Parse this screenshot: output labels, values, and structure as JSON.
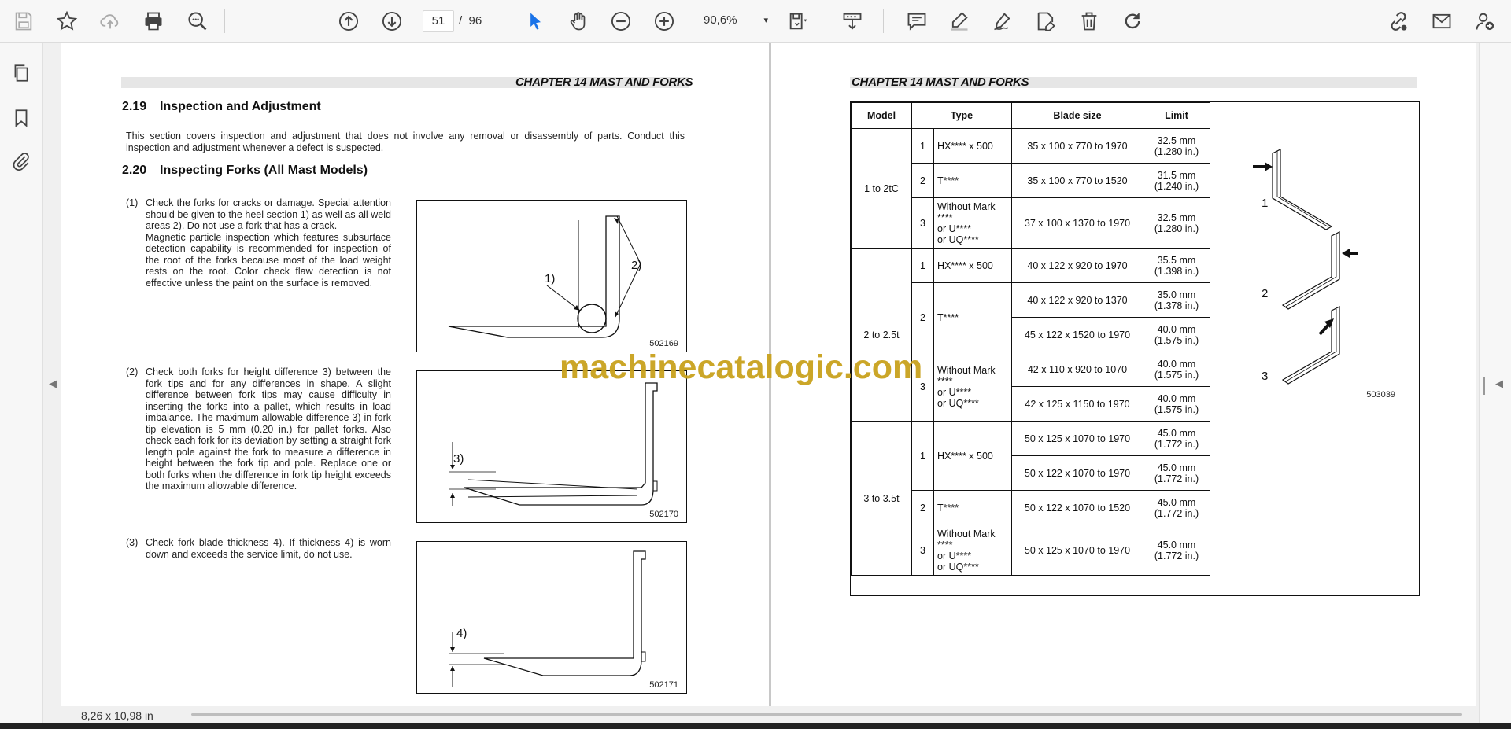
{
  "toolbar": {
    "page_current": "51",
    "page_separator": "/",
    "page_total": "96",
    "zoom": "90,6%",
    "zoom_caret": "▾"
  },
  "left_page": {
    "chapter": "CHAPTER 14 MAST AND FORKS",
    "section1": {
      "num": "2.19",
      "title": "Inspection and Adjustment"
    },
    "section1_text": "This section covers inspection and adjustment that does not involve any removal or disassembly of parts. Conduct this inspection and adjustment whenever a defect is suspected.",
    "section2": {
      "num": "2.20",
      "title": "Inspecting Forks (All Mast Models)"
    },
    "items": [
      {
        "num": "(1)",
        "text": "Check the forks for cracks or damage. Special attention should be given to the heel section 1) as well as all weld areas 2). Do not use a fork that has a crack.\nMagnetic particle inspection which features subsurface detection capability is recommended for inspection of the root of the forks because most of the load weight rests on the root. Color check flaw detection is not effective unless the paint on the surface is removed."
      },
      {
        "num": "(2)",
        "text": "Check both forks for height difference 3) between the fork tips and for any differences in shape. A slight difference between fork tips may cause difficulty in inserting the forks into a pallet, which results in load imbalance. The maximum allowable difference 3) in fork tip elevation is 5 mm (0.20 in.) for pallet forks. Also check each fork for its deviation by setting a straight fork length pole against the fork to measure a difference in height between the fork tip and pole. Replace one or both forks when the difference in fork tip height exceeds the maximum allowable difference."
      },
      {
        "num": "(3)",
        "text": "Check fork blade thickness 4). If thickness 4) is worn down and exceeds the service limit, do not use."
      }
    ],
    "figures": [
      {
        "code": "502169",
        "label_a": "1)",
        "label_b": "2)"
      },
      {
        "code": "502170",
        "label_a": "3)"
      },
      {
        "code": "502171",
        "label_a": "4)"
      }
    ]
  },
  "right_page": {
    "chapter": "CHAPTER 14 MAST AND FORKS",
    "table_headers": [
      "Model",
      "Type",
      "Blade size",
      "Limit"
    ],
    "groups": [
      {
        "model": "1 to 2tC",
        "rows": [
          {
            "n": "1",
            "type": [
              "HX**** x 500"
            ],
            "blades": [
              {
                "size": "35 x 100 x 770 to 1970",
                "limit": "32.5 mm",
                "limit_in": "(1.280 in.)"
              }
            ]
          },
          {
            "n": "2",
            "type": [
              "T****"
            ],
            "blades": [
              {
                "size": "35 x 100 x 770 to 1520",
                "limit": "31.5 mm",
                "limit_in": "(1.240 in.)"
              }
            ]
          },
          {
            "n": "3",
            "type": [
              "Without Mark",
              "****",
              "or U****",
              "or UQ****"
            ],
            "blades": [
              {
                "size": "37 x 100 x 1370 to 1970",
                "limit": "32.5 mm",
                "limit_in": "(1.280 in.)"
              }
            ]
          }
        ]
      },
      {
        "model": "2 to 2.5t",
        "rows": [
          {
            "n": "1",
            "type": [
              "HX**** x 500"
            ],
            "blades": [
              {
                "size": "40 x 122 x 920 to 1970",
                "limit": "35.5 mm",
                "limit_in": "(1.398 in.)"
              }
            ]
          },
          {
            "n": "2",
            "type": [
              "T****"
            ],
            "blades": [
              {
                "size": "40 x 122 x 920 to 1370",
                "limit": "35.0 mm",
                "limit_in": "(1.378 in.)"
              },
              {
                "size": "45 x 122 x 1520 to 1970",
                "limit": "40.0 mm",
                "limit_in": "(1.575 in.)"
              }
            ]
          },
          {
            "n": "3",
            "type": [
              "Without Mark",
              "****",
              "or U****",
              "or UQ****"
            ],
            "blades": [
              {
                "size": "42 x 110 x 920 to 1070",
                "limit": "40.0 mm",
                "limit_in": "(1.575 in.)"
              },
              {
                "size": "42 x 125 x 1150 to 1970",
                "limit": "40.0 mm",
                "limit_in": "(1.575 in.)"
              }
            ]
          }
        ]
      },
      {
        "model": "3 to 3.5t",
        "rows": [
          {
            "n": "1",
            "type": [
              "HX**** x 500"
            ],
            "blades": [
              {
                "size": "50 x 125 x 1070 to 1970",
                "limit": "45.0 mm",
                "limit_in": "(1.772 in.)"
              },
              {
                "size": "50 x 122 x 1070 to 1970",
                "limit": "45.0 mm",
                "limit_in": "(1.772 in.)"
              }
            ]
          },
          {
            "n": "2",
            "type": [
              "T****"
            ],
            "blades": [
              {
                "size": "50 x 122 x 1070 to 1520",
                "limit": "45.0 mm",
                "limit_in": "(1.772 in.)"
              }
            ]
          },
          {
            "n": "3",
            "type": [
              "Without Mark",
              "****",
              "or U****",
              "or UQ****"
            ],
            "blades": [
              {
                "size": "50 x 125 x 1070 to 1970",
                "limit": "45.0 mm",
                "limit_in": "(1.772 in.)"
              }
            ]
          }
        ]
      }
    ],
    "diagram_labels": [
      "1",
      "2",
      "3"
    ],
    "diagram_code": "503039"
  },
  "watermark": "machinecatalogic.com",
  "status": {
    "page_size": "8,26 x 10,98 in"
  },
  "icons": {
    "toolbar": [
      "save-icon",
      "bookmark-star-icon",
      "cloud-upload-icon",
      "print-icon",
      "zoom-search-icon",
      "page-up-icon",
      "page-down-icon",
      "select-cursor-icon",
      "hand-tool-icon",
      "zoom-out-icon",
      "zoom-in-icon",
      "page-fit-icon",
      "scroll-mode-icon",
      "comment-icon",
      "highlight-pen-icon",
      "draw-icon",
      "fill-sign-icon",
      "delete-icon",
      "rotate-icon",
      "share-link-icon",
      "email-icon",
      "add-user-icon"
    ],
    "rail": [
      "pages-icon",
      "bookmarks-icon",
      "attachments-icon"
    ]
  }
}
